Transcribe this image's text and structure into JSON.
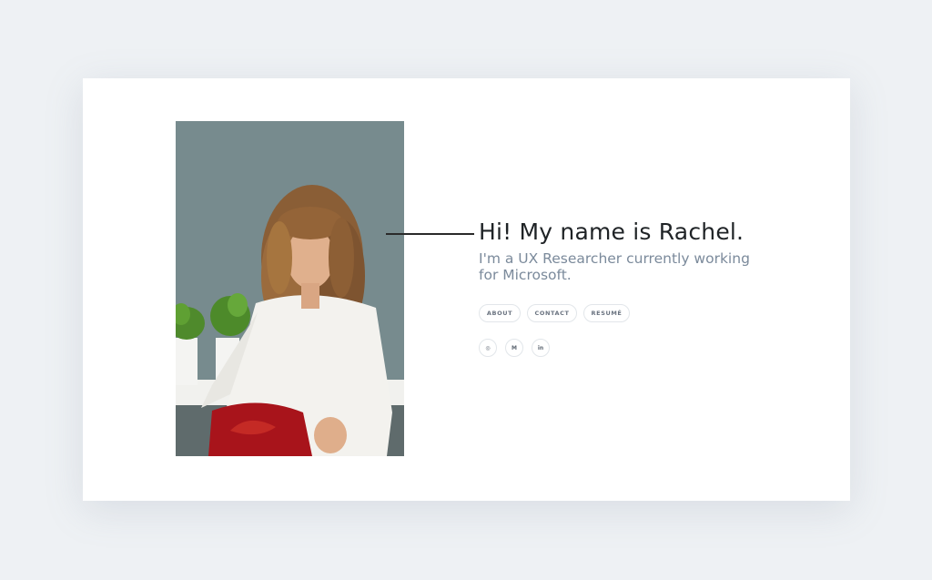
{
  "hero": {
    "headline": "Hi! My name is Rachel.",
    "subline": "I'm a UX Researcher currently working for Microsoft."
  },
  "nav": {
    "items": [
      {
        "label": "ABOUT"
      },
      {
        "label": "CONTACT"
      },
      {
        "label": "RESUMÉ"
      }
    ]
  },
  "social": {
    "items": [
      {
        "icon": "dribbble-icon",
        "glyph": "◎"
      },
      {
        "icon": "medium-icon",
        "glyph": "M"
      },
      {
        "icon": "linkedin-icon",
        "glyph": "in"
      }
    ]
  },
  "colors": {
    "background": "#eef1f4",
    "card": "#ffffff",
    "headline": "#1f2326",
    "subline": "#7b8a9b",
    "pill_border": "#e2e6ea"
  }
}
